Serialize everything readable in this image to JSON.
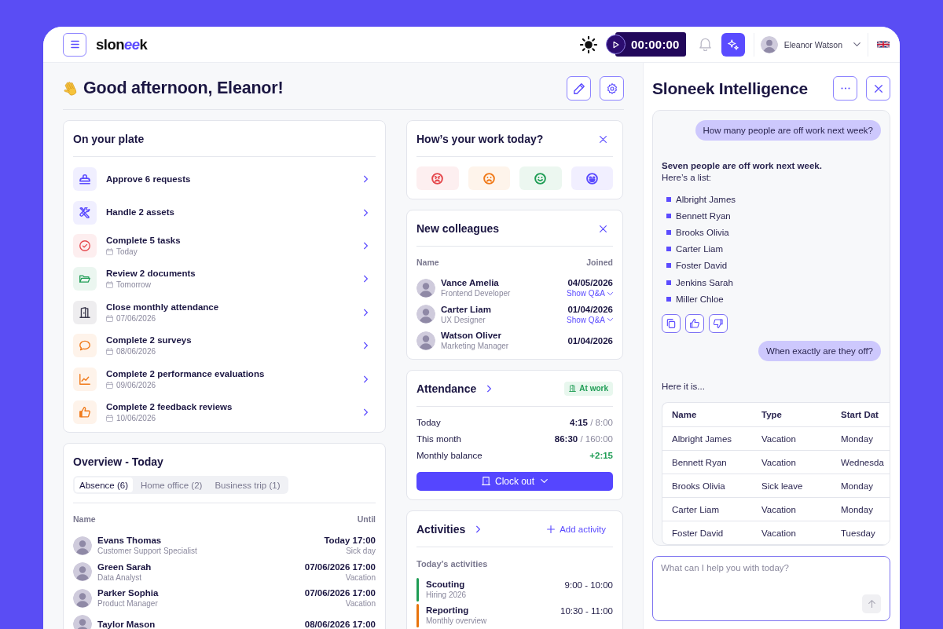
{
  "header": {
    "logo": [
      {
        "text": "slon",
        "accent": false
      },
      {
        "text": "ee",
        "accent": true
      },
      {
        "text": "k",
        "accent": false
      }
    ],
    "timer": "00:00:00",
    "user_name": "Eleanor Watson"
  },
  "greeting": "Good afternoon, Eleanor!",
  "plate": {
    "title": "On your plate",
    "items": [
      {
        "kind": "approval",
        "color": "#5b4bff",
        "label": "Approve 6 requests"
      },
      {
        "kind": "assets",
        "color": "#5b4bff",
        "label": "Handle 2 assets"
      },
      {
        "kind": "tasks",
        "color": "#e5484d",
        "label": "Complete 5 tasks",
        "date": "Today"
      },
      {
        "kind": "documents",
        "color": "#1f9d55",
        "label": "Review 2 documents",
        "date": "Tomorrow"
      },
      {
        "kind": "attendance",
        "color": "#3d3b4f",
        "label": "Close monthly attendance",
        "date": "07/06/2026"
      },
      {
        "kind": "surveys",
        "color": "#f07a1a",
        "label": "Complete 2 surveys",
        "date": "08/06/2026"
      },
      {
        "kind": "evaluations",
        "color": "#f07a1a",
        "label": "Complete 2 performance evaluations",
        "date": "09/06/2026"
      },
      {
        "kind": "feedback",
        "color": "#f07a1a",
        "label": "Complete 2 feedback reviews",
        "date": "10/06/2026"
      }
    ]
  },
  "overview": {
    "title": "Overview - Today",
    "tabs": [
      {
        "label": "Absence (6)",
        "selected": true
      },
      {
        "label": "Home office (2)",
        "selected": false
      },
      {
        "label": "Business trip (1)",
        "selected": false
      }
    ],
    "columns": [
      "Name",
      "Until"
    ],
    "rows": [
      {
        "name": "Evans Thomas",
        "role": "Customer Support Specialist",
        "until": "Today 17:00",
        "type": "Sick day"
      },
      {
        "name": "Green Sarah",
        "role": "Data Analyst",
        "until": "07/06/2026 17:00",
        "type": "Vacation"
      },
      {
        "name": "Parker Sophia",
        "role": "Product Manager",
        "until": "07/06/2026 17:00",
        "type": "Vacation"
      },
      {
        "name": "Taylor Mason",
        "until": "08/06/2026 17:00"
      }
    ]
  },
  "mood": {
    "title": "How’s your work today?",
    "options": [
      {
        "kind": "angry",
        "color": "#e5484d"
      },
      {
        "kind": "sad",
        "color": "#f07a1a"
      },
      {
        "kind": "happy",
        "color": "#1f9d55"
      },
      {
        "kind": "joyful",
        "color": "#5b4bff"
      }
    ]
  },
  "colleagues": {
    "title": "New colleagues",
    "columns": [
      "Name",
      "Joined"
    ],
    "rows": [
      {
        "name": "Vance Amelia",
        "role": "Frontend Developer",
        "joined": "04/05/2026",
        "link": "Show Q&A"
      },
      {
        "name": "Carter Liam",
        "role": "UX Designer",
        "joined": "01/04/2026",
        "link": "Show Q&A"
      },
      {
        "name": "Watson Oliver",
        "role": "Marketing Manager",
        "joined": "01/04/2026"
      }
    ]
  },
  "attendance": {
    "title": "Attendance",
    "status": "At work",
    "rows": [
      {
        "kind": "ratio",
        "label": "Today",
        "value": "**4:15** / 8:00"
      },
      {
        "kind": "ratio",
        "label": "This month",
        "value": "**86:30** / 160:00"
      },
      {
        "kind": "balance",
        "label": "Monthly balance",
        "value": "+2:15"
      }
    ],
    "button": "Clock out"
  },
  "activities": {
    "title": "Activities",
    "add": "Add activity",
    "subtitle": "Today’s activities",
    "items": [
      {
        "name": "Scouting",
        "detail": "Hiring 2026",
        "time": "9:00 - 10:00",
        "color": "#1f9d55"
      },
      {
        "name": "Reporting",
        "detail": "Monthly overview",
        "time": "10:30 - 11:00",
        "color": "#e8740c"
      }
    ]
  },
  "assistant": {
    "title": "Sloneek Intelligence",
    "messages": [
      {
        "kind": "user",
        "text": "How many people are off work next week?"
      },
      {
        "kind": "answer",
        "lead": "Seven people are off work next week.",
        "text": "Here’s a list:",
        "list": [
          "Albright James",
          "Bennett Ryan",
          "Brooks Olivia",
          "Carter Liam",
          "Foster David",
          "Jenkins Sarah",
          "Miller Chloe"
        ],
        "feedback": true
      },
      {
        "kind": "user",
        "text": "When exactly are they off?"
      },
      {
        "kind": "answer",
        "text": "Here it is...",
        "table": {
          "columns": [
            "Name",
            "Type",
            "Start Dat"
          ],
          "rows": [
            [
              "Albright James",
              "Vacation",
              "Monday"
            ],
            [
              "Bennett Ryan",
              "Vacation",
              "Wednesda"
            ],
            [
              "Brooks Olivia",
              "Sick leave",
              "Monday"
            ],
            [
              "Carter Liam",
              "Vacation",
              "Monday"
            ],
            [
              "Foster David",
              "Vacation",
              "Tuesday"
            ]
          ]
        }
      }
    ],
    "placeholder": "What can I help you with today?"
  }
}
